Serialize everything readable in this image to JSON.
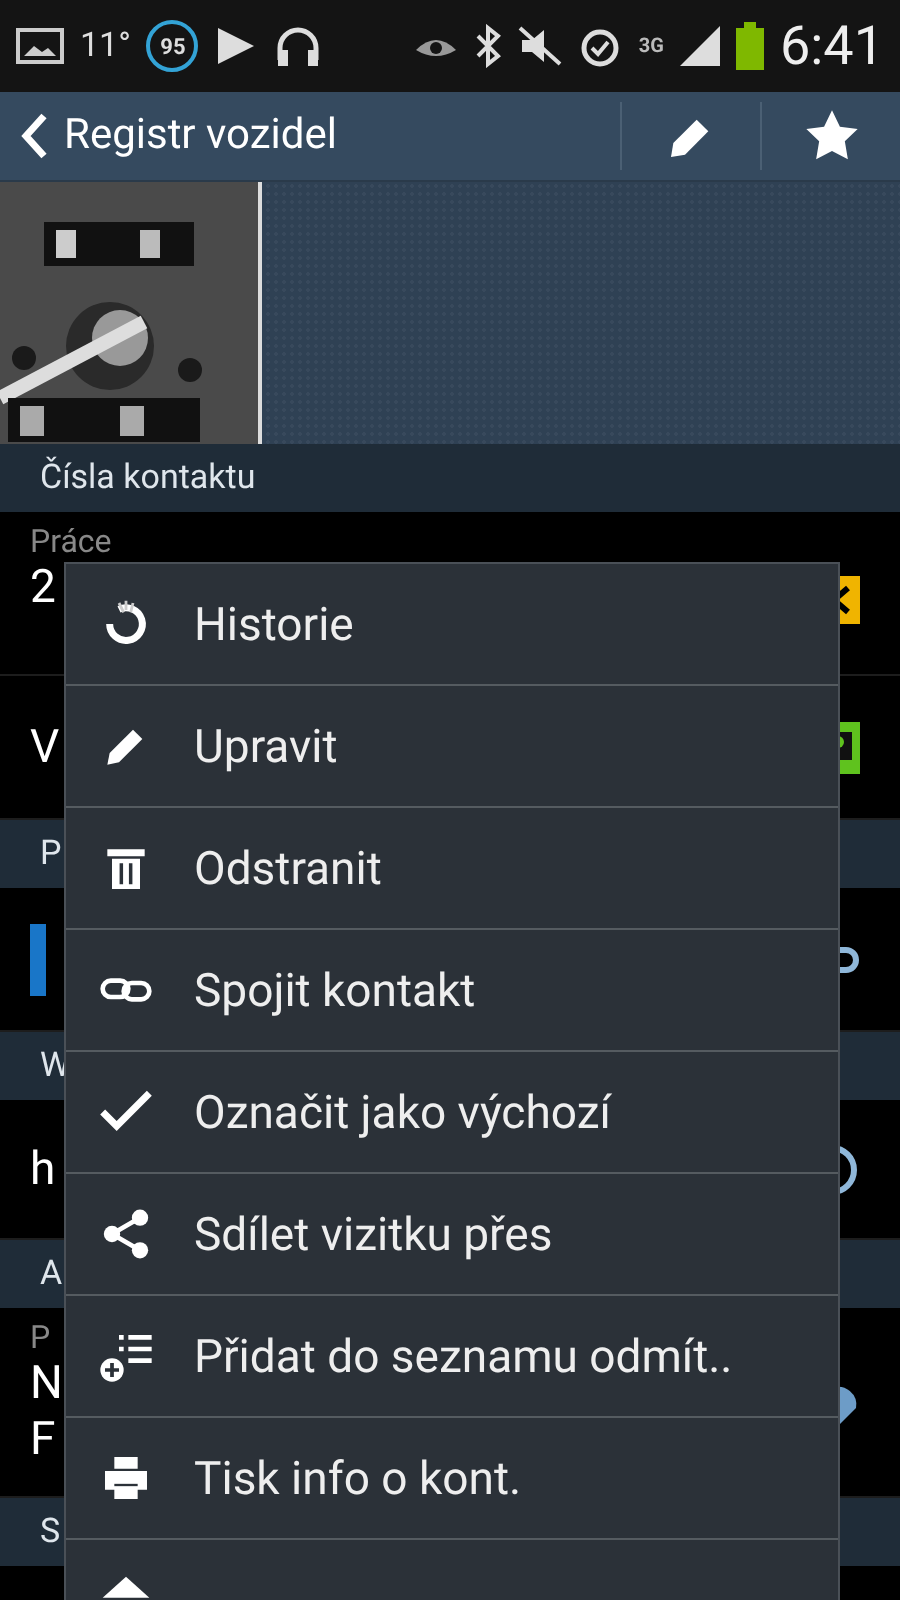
{
  "status_bar": {
    "temperature": "11°",
    "badge": "95",
    "network": "3G",
    "time": "6:41"
  },
  "action_bar": {
    "title": "Registr vozidel"
  },
  "sections": [
    {
      "header": "Čísla kontaktu",
      "rows": [
        {
          "kind": "phone",
          "label": "Práce",
          "value": "2"
        },
        {
          "kind": "contact",
          "value": "V"
        }
      ]
    },
    {
      "header": "P",
      "rows": [
        {
          "kind": "linked"
        }
      ]
    },
    {
      "header": "W",
      "rows": [
        {
          "kind": "web",
          "value": "h"
        }
      ]
    },
    {
      "header": "A",
      "rows": [
        {
          "kind": "address",
          "label": "P",
          "value": "N",
          "value2": "F"
        }
      ]
    },
    {
      "header": "S"
    }
  ],
  "menu": [
    {
      "kind": "history",
      "label": "Historie"
    },
    {
      "kind": "edit",
      "label": "Upravit"
    },
    {
      "kind": "delete",
      "label": "Odstranit"
    },
    {
      "kind": "link",
      "label": "Spojit kontakt"
    },
    {
      "kind": "check",
      "label": "Označit jako výchozí"
    },
    {
      "kind": "share",
      "label": "Sdílet vizitku přes"
    },
    {
      "kind": "reject",
      "label": "Přidat do seznamu odmít.."
    },
    {
      "kind": "print",
      "label": "Tisk info o kont."
    },
    {
      "kind": "home"
    }
  ]
}
